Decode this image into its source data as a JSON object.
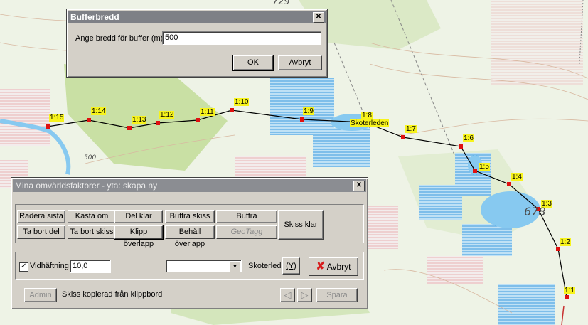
{
  "map": {
    "height_labels": [
      "729",
      "678",
      "500"
    ],
    "route_name": "Skoterleden",
    "vertices": [
      "1:15",
      "1:14",
      "1:13",
      "1:12",
      "1:11",
      "1:10",
      "1:9",
      "1:8",
      "1:7",
      "1:6",
      "1:5",
      "1:4",
      "1:3",
      "1:2",
      "1:1"
    ]
  },
  "buffer_dialog": {
    "title": "Bufferbredd",
    "prompt_label": "Ange bredd för buffer (m):",
    "width_value": "500",
    "ok_label": "OK",
    "cancel_label": "Avbryt"
  },
  "factors_window": {
    "title": "Mina omvärldsfaktorer - yta: skapa ny",
    "buttons": {
      "radera_sista": "Radera sista",
      "kasta_om": "Kasta om",
      "del_klar": "Del klar",
      "buffra_skiss": "Buffra skiss",
      "buffra_markerade": "Buffra markerade",
      "ta_bort_del": "Ta bort del",
      "ta_bort_skiss": "Ta bort skiss",
      "klipp_overlapp": "Klipp överlapp",
      "behall_overlapp": "Behåll överlapp",
      "geotagg": "GeoTagg",
      "skiss_klar": "Skiss klar"
    },
    "snap_label": "Vidhäftning",
    "snap_checked": "✓",
    "snap_value": "10,0",
    "layer_select_value": "",
    "skoterleder_label": "Skoterleder",
    "skoterleder_btn": "(Y)",
    "avbryt_label": "Avbryt",
    "admin_label": "Admin",
    "status_text": "Skiss kopierad från klippbord",
    "spara_label": "Spara"
  },
  "colors": {
    "vertex": "#e01010",
    "label_bg": "#f7f31c",
    "water_lines": "#3d9be0",
    "lake": "#87c9f0",
    "forest": "#c5dfa0"
  }
}
